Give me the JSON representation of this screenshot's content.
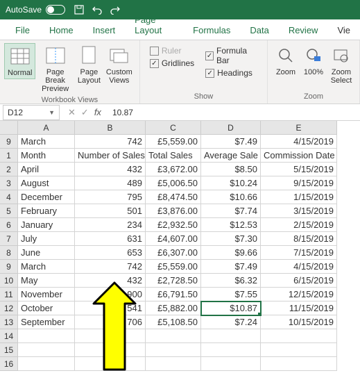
{
  "titlebar": {
    "autosave": "AutoSave"
  },
  "tabs": [
    "File",
    "Home",
    "Insert",
    "Page Layout",
    "Formulas",
    "Data",
    "Review",
    "Vie"
  ],
  "ribbon": {
    "views": {
      "normal": "Normal",
      "pbp": "Page Break\nPreview",
      "pl": "Page\nLayout",
      "cv": "Custom\nViews",
      "label": "Workbook Views"
    },
    "show": {
      "ruler": "Ruler",
      "fb": "Formula Bar",
      "gl": "Gridlines",
      "hd": "Headings",
      "label": "Show"
    },
    "zoom": {
      "zoom": "Zoom",
      "z100": "100%",
      "zs": "Zoom\nSelect",
      "label": "Zoom"
    }
  },
  "namebox": "D12",
  "fvalue": "10.87",
  "cols": [
    "A",
    "B",
    "C",
    "D",
    "E"
  ],
  "rows": [
    {
      "n": "9",
      "a": "March",
      "b": "742",
      "c": "£5,559.00",
      "d": "$7.49",
      "e": "4/15/2019"
    },
    {
      "n": "1",
      "a": "Month",
      "b": "Number of Sales",
      "c": "Total Sales",
      "d": "Average Sale",
      "e": "Commission Date",
      "hdr": true
    },
    {
      "n": "2",
      "a": "April",
      "b": "432",
      "c": "£3,672.00",
      "d": "$8.50",
      "e": "5/15/2019"
    },
    {
      "n": "3",
      "a": "August",
      "b": "489",
      "c": "£5,006.50",
      "d": "$10.24",
      "e": "9/15/2019"
    },
    {
      "n": "4",
      "a": "December",
      "b": "795",
      "c": "£8,474.50",
      "d": "$10.66",
      "e": "1/15/2019"
    },
    {
      "n": "5",
      "a": "February",
      "b": "501",
      "c": "£3,876.00",
      "d": "$7.74",
      "e": "3/15/2019"
    },
    {
      "n": "6",
      "a": "January",
      "b": "234",
      "c": "£2,932.50",
      "d": "$12.53",
      "e": "2/15/2019"
    },
    {
      "n": "7",
      "a": "July",
      "b": "631",
      "c": "£4,607.00",
      "d": "$7.30",
      "e": "8/15/2019"
    },
    {
      "n": "8",
      "a": "June",
      "b": "653",
      "c": "£6,307.00",
      "d": "$9.66",
      "e": "7/15/2019"
    },
    {
      "n": "9",
      "a": "March",
      "b": "742",
      "c": "£5,559.00",
      "d": "$7.49",
      "e": "4/15/2019"
    },
    {
      "n": "10",
      "a": "May",
      "b": "432",
      "c": "£2,728.50",
      "d": "$6.32",
      "e": "6/15/2019"
    },
    {
      "n": "11",
      "a": "November",
      "b": "900",
      "c": "£6,791.50",
      "d": "$7.55",
      "e": "12/15/2019"
    },
    {
      "n": "12",
      "a": "October",
      "b": "541",
      "c": "£5,882.00",
      "d": "$10.87",
      "e": "11/15/2019",
      "sel": true
    },
    {
      "n": "13",
      "a": "September",
      "b": "706",
      "c": "£5,108.50",
      "d": "$7.24",
      "e": "10/15/2019"
    },
    {
      "n": "14",
      "a": "",
      "b": "",
      "c": "",
      "d": "",
      "e": ""
    },
    {
      "n": "15",
      "a": "",
      "b": "",
      "c": "",
      "d": "",
      "e": ""
    },
    {
      "n": "16",
      "a": "",
      "b": "",
      "c": "",
      "d": "",
      "e": ""
    }
  ]
}
